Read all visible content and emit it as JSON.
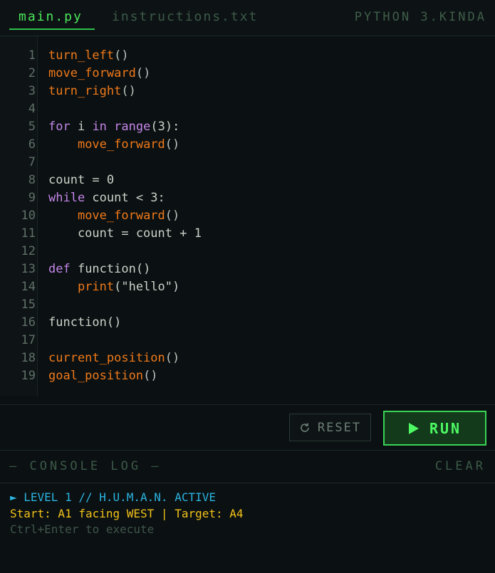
{
  "tabs": {
    "active": "main.py",
    "inactive": "instructions.txt",
    "language": "PYTHON 3.KINDA"
  },
  "editor": {
    "lines": [
      {
        "n": "1",
        "parts": [
          {
            "t": "turn_left",
            "c": "fn"
          },
          {
            "t": "()",
            "c": "paren"
          }
        ]
      },
      {
        "n": "2",
        "parts": [
          {
            "t": "move_forward",
            "c": "fn"
          },
          {
            "t": "()",
            "c": "paren"
          }
        ]
      },
      {
        "n": "3",
        "parts": [
          {
            "t": "turn_right",
            "c": "fn"
          },
          {
            "t": "()",
            "c": "paren"
          }
        ]
      },
      {
        "n": "4",
        "parts": []
      },
      {
        "n": "5",
        "parts": [
          {
            "t": "for",
            "c": "kw"
          },
          {
            "t": " i ",
            "c": "plain"
          },
          {
            "t": "in",
            "c": "kw"
          },
          {
            "t": " ",
            "c": "plain"
          },
          {
            "t": "range",
            "c": "kw"
          },
          {
            "t": "(3):",
            "c": "plain"
          }
        ]
      },
      {
        "n": "6",
        "parts": [
          {
            "t": "    ",
            "c": "plain"
          },
          {
            "t": "move_forward",
            "c": "fn"
          },
          {
            "t": "()",
            "c": "paren"
          }
        ]
      },
      {
        "n": "7",
        "parts": []
      },
      {
        "n": "8",
        "parts": [
          {
            "t": "count = 0",
            "c": "plain"
          }
        ]
      },
      {
        "n": "9",
        "parts": [
          {
            "t": "while",
            "c": "kw"
          },
          {
            "t": " count < 3:",
            "c": "plain"
          }
        ]
      },
      {
        "n": "10",
        "parts": [
          {
            "t": "    ",
            "c": "plain"
          },
          {
            "t": "move_forward",
            "c": "fn"
          },
          {
            "t": "()",
            "c": "paren"
          }
        ]
      },
      {
        "n": "11",
        "parts": [
          {
            "t": "    count = count + 1",
            "c": "plain"
          }
        ]
      },
      {
        "n": "12",
        "parts": []
      },
      {
        "n": "13",
        "parts": [
          {
            "t": "def",
            "c": "kw"
          },
          {
            "t": " function()",
            "c": "plain"
          }
        ]
      },
      {
        "n": "14",
        "parts": [
          {
            "t": "    ",
            "c": "plain"
          },
          {
            "t": "print",
            "c": "fn"
          },
          {
            "t": "(\"hello\")",
            "c": "plain"
          }
        ]
      },
      {
        "n": "15",
        "parts": []
      },
      {
        "n": "16",
        "parts": [
          {
            "t": "function()",
            "c": "plain"
          }
        ]
      },
      {
        "n": "17",
        "parts": []
      },
      {
        "n": "18",
        "parts": [
          {
            "t": "current_position",
            "c": "fn"
          },
          {
            "t": "()",
            "c": "paren"
          }
        ]
      },
      {
        "n": "19",
        "parts": [
          {
            "t": "goal_position",
            "c": "fn"
          },
          {
            "t": "()",
            "c": "paren"
          }
        ]
      }
    ]
  },
  "toolbar": {
    "reset_label": "RESET",
    "run_label": "RUN"
  },
  "console": {
    "title": "— CONSOLE LOG —",
    "clear_label": "CLEAR",
    "log": [
      "► LEVEL 1 // H.U.M.A.N. ACTIVE",
      "Start: A1 facing WEST | Target: A4",
      "Ctrl+Enter to execute"
    ]
  },
  "colors": {
    "accent": "#4be85a",
    "function": "#f07a1a",
    "keyword": "#c486e8",
    "info": "#2ab4e0",
    "warn": "#f2c21a"
  }
}
